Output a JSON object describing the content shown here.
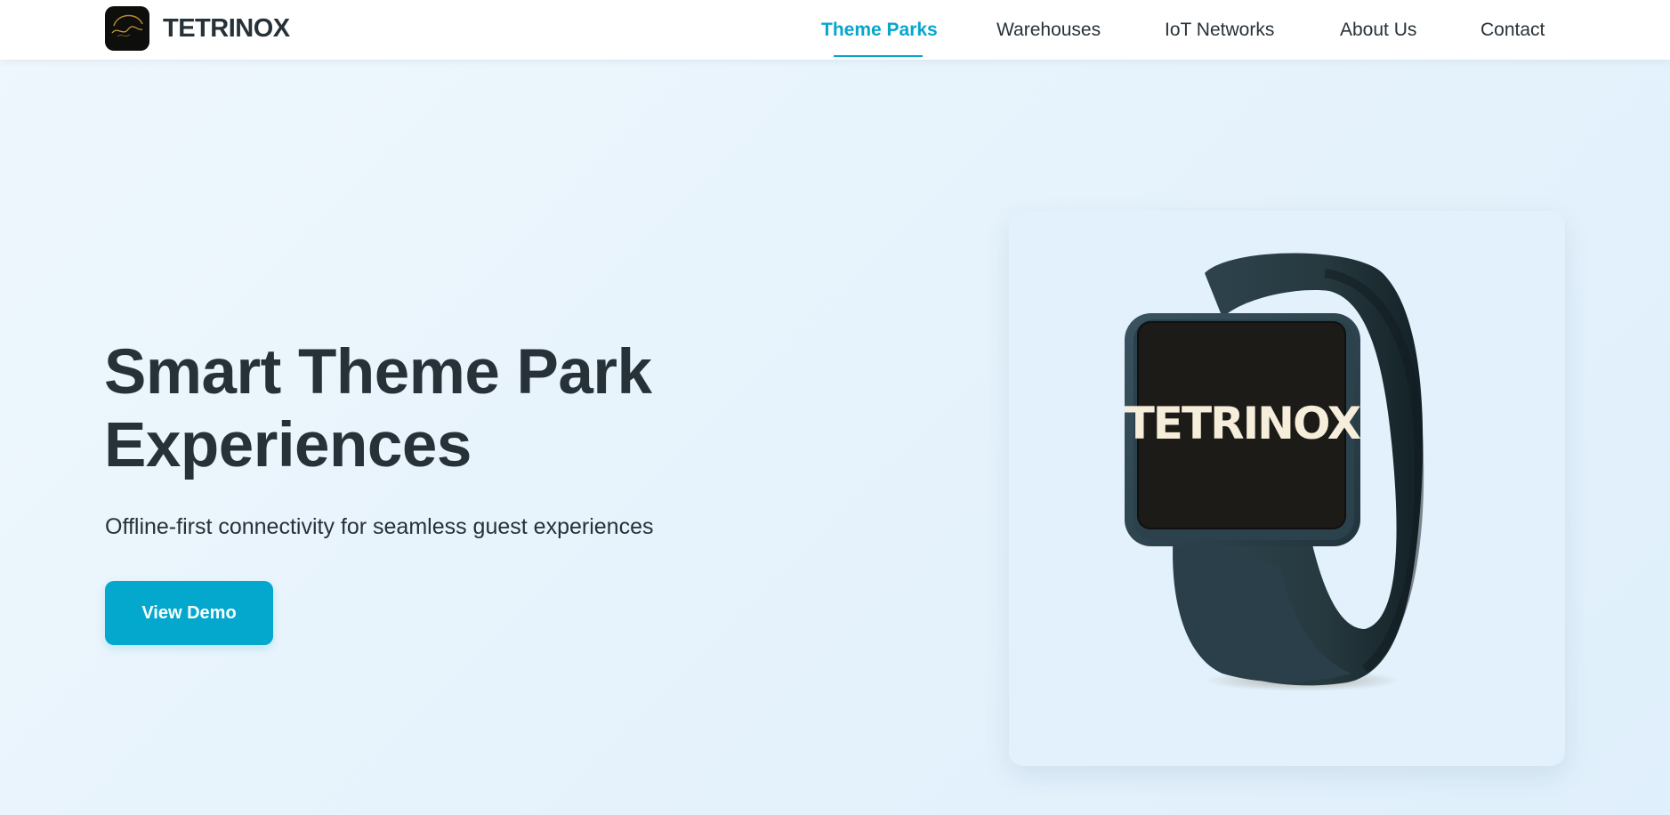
{
  "brand": {
    "name": "TETRINOX"
  },
  "nav": {
    "items": [
      {
        "label": "Theme Parks",
        "active": true
      },
      {
        "label": "Warehouses",
        "active": false
      },
      {
        "label": "IoT Networks",
        "active": false
      },
      {
        "label": "About Us",
        "active": false
      },
      {
        "label": "Contact",
        "active": false
      }
    ]
  },
  "hero": {
    "title_line1": "Smart Theme Park",
    "title_line2": "Experiences",
    "subtitle": "Offline-first connectivity for seamless guest experiences",
    "cta_label": "View Demo"
  },
  "product": {
    "screen_text": "TETRINOX",
    "icon": "smartwatch-wristband"
  },
  "colors": {
    "accent": "#06a6cd",
    "text": "#273238",
    "band": "#2a3d47",
    "screen": "#1c1b18",
    "screen_text": "#f6eedb"
  }
}
